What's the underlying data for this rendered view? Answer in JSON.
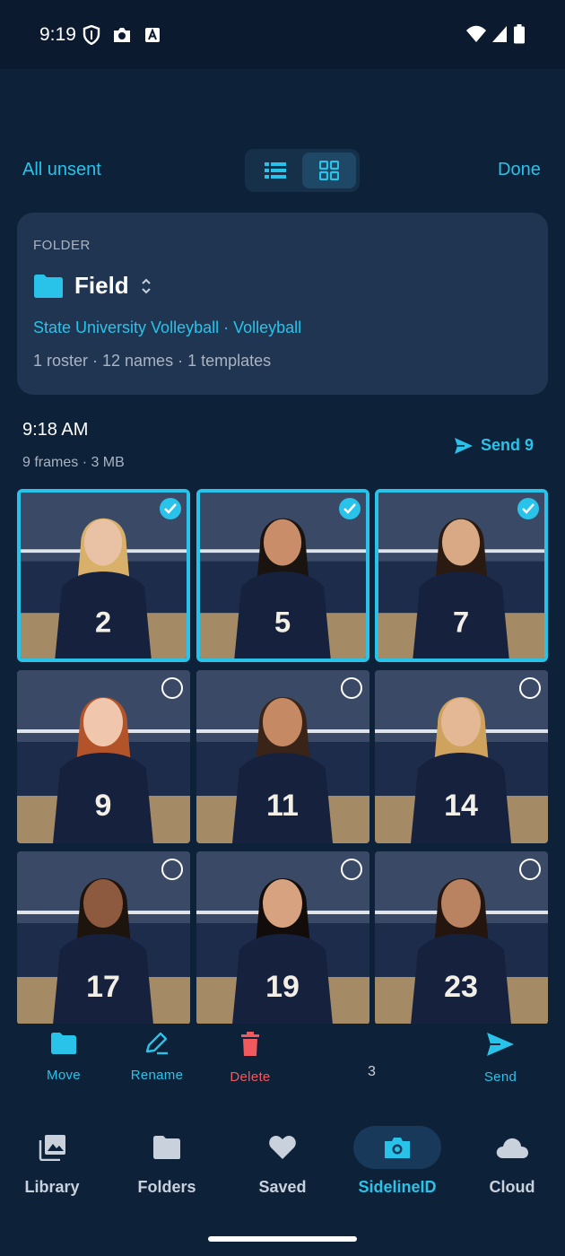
{
  "status_bar": {
    "time": "9:19",
    "icons": [
      "shield-icon",
      "camera-icon",
      "font-a-icon",
      "wifi-icon",
      "cellular-icon",
      "battery-icon"
    ]
  },
  "topbar": {
    "left_link": "All unsent",
    "right_link": "Done",
    "view_toggle": {
      "options": [
        "list-view-icon",
        "grid-view-icon"
      ],
      "selected": "grid"
    }
  },
  "folder": {
    "section_label": "FOLDER",
    "name": "Field",
    "team_line": "State University Volleyball · Volleyball",
    "meta_line": "1 roster · 12 names · 1 templates"
  },
  "group": {
    "time": "9:18 AM",
    "meta": "9 frames · 3 MB",
    "send_label": "Send 9"
  },
  "photos": [
    {
      "jersey": "2",
      "selected": true
    },
    {
      "jersey": "5",
      "selected": true
    },
    {
      "jersey": "7",
      "selected": true
    },
    {
      "jersey": "9",
      "selected": false
    },
    {
      "jersey": "11",
      "selected": false
    },
    {
      "jersey": "14",
      "selected": false
    },
    {
      "jersey": "17",
      "selected": false
    },
    {
      "jersey": "19",
      "selected": false
    },
    {
      "jersey": "23",
      "selected": false
    }
  ],
  "action_bar": {
    "move": "Move",
    "rename": "Rename",
    "delete": "Delete",
    "selected_count": "3",
    "send": "Send"
  },
  "bottom_nav": {
    "items": [
      {
        "label": "Library",
        "icon": "photo-library-icon"
      },
      {
        "label": "Folders",
        "icon": "folder-icon"
      },
      {
        "label": "Saved",
        "icon": "heart-icon"
      },
      {
        "label": "SidelineID",
        "icon": "camera-icon"
      },
      {
        "label": "Cloud",
        "icon": "cloud-icon"
      }
    ],
    "active": "SidelineID"
  },
  "colors": {
    "background": "#0d2139",
    "accent": "#29c3ea",
    "card": "#203551",
    "delete": "#f05a5f"
  }
}
